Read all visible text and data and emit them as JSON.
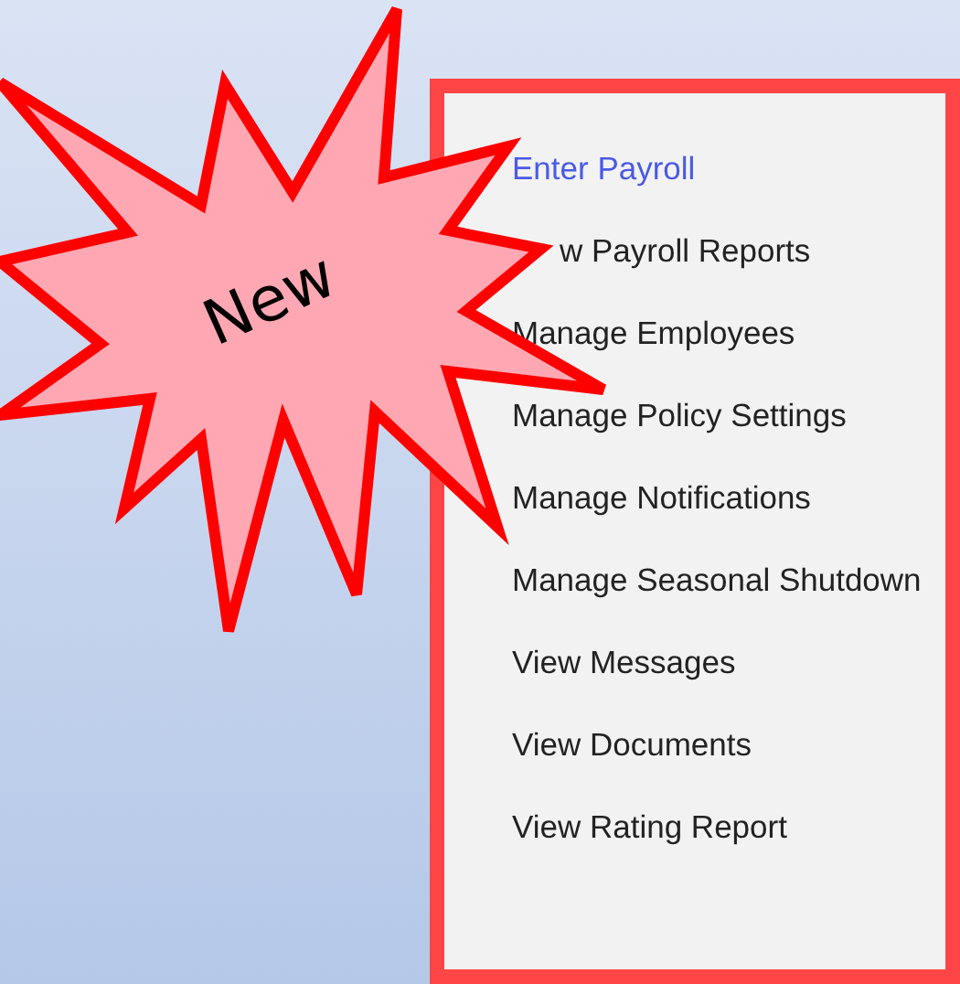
{
  "badge": {
    "label": "New"
  },
  "menu": {
    "items": [
      {
        "label": "Enter Payroll",
        "selected": true
      },
      {
        "label": "w Payroll Reports",
        "selected": false,
        "partly_hidden": true
      },
      {
        "label": "Manage Employees",
        "selected": false
      },
      {
        "label": "Manage Policy Settings",
        "selected": false
      },
      {
        "label": "Manage Notifications",
        "selected": false
      },
      {
        "label": "Manage Seasonal Shutdown",
        "selected": false
      },
      {
        "label": "View Messages",
        "selected": false
      },
      {
        "label": "View Documents",
        "selected": false
      },
      {
        "label": "View Rating Report",
        "selected": false
      }
    ]
  }
}
